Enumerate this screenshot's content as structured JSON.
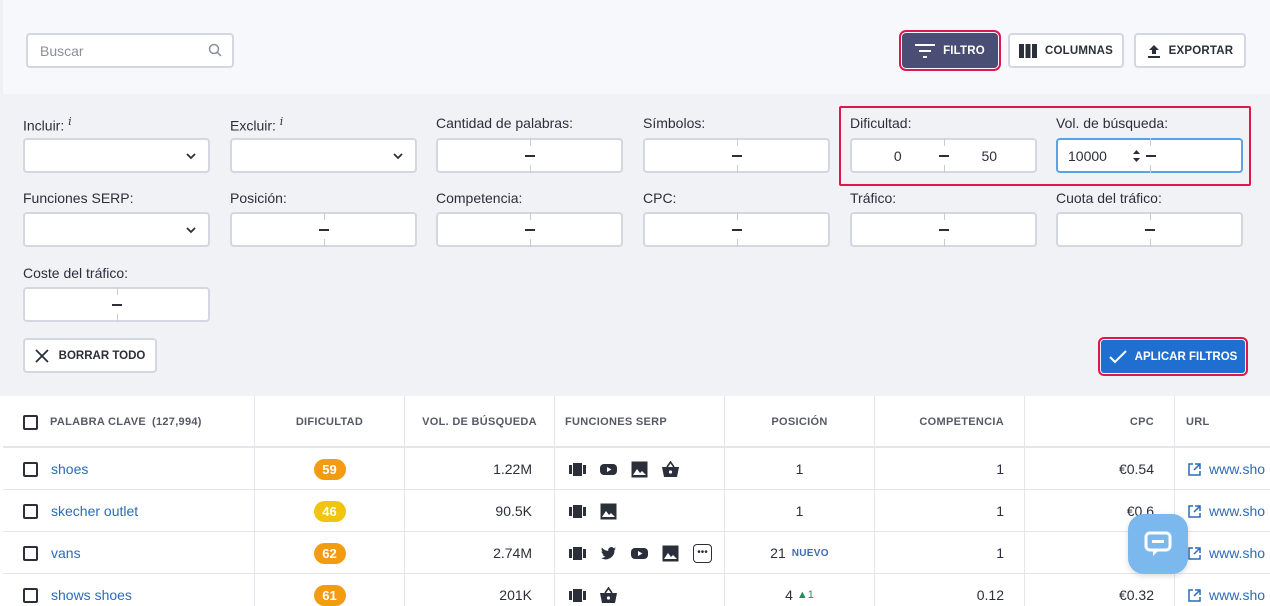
{
  "toolbar": {
    "search_placeholder": "Buscar",
    "filter_label": "FILTRO",
    "columns_label": "COLUMNAS",
    "export_label": "EXPORTAR"
  },
  "filters": {
    "incluir": "Incluir:",
    "excluir": "Excluir:",
    "info_glyph": "i",
    "cantidad": "Cantidad de palabras:",
    "simbolos": "Símbolos:",
    "dificultad": "Dificultad:",
    "dificultad_min": "0",
    "dificultad_max": "50",
    "volumen": "Vol. de búsqueda:",
    "volumen_min": "10000",
    "funciones": "Funciones SERP:",
    "posicion": "Posición:",
    "competencia": "Competencia:",
    "cpc": "CPC:",
    "trafico": "Tráfico:",
    "cuota": "Cuota del tráfico:",
    "coste": "Coste del tráfico:",
    "clear_label": "BORRAR TODO",
    "apply_label": "APLICAR FILTROS"
  },
  "table": {
    "headers": {
      "keyword": "PALABRA CLAVE",
      "keyword_count": "(127,994)",
      "difficulty": "DIFICULTAD",
      "volume": "VOL. DE BÚSQUEDA",
      "serp": "FUNCIONES SERP",
      "position": "POSICIÓN",
      "competition": "COMPETENCIA",
      "cpc": "CPC",
      "url": "URL"
    },
    "rows": [
      {
        "keyword": "shoes",
        "difficulty": "59",
        "difficulty_color": "#f39c12",
        "volume": "1.22M",
        "serp": [
          "carousel-icon",
          "youtube-icon",
          "image-icon",
          "shopping-icon"
        ],
        "position": "1",
        "position_tag": "",
        "position_change": "",
        "competition": "1",
        "cpc": "€0.54",
        "url": "www.sho"
      },
      {
        "keyword": "skecher outlet",
        "difficulty": "46",
        "difficulty_color": "#f1c40f",
        "volume": "90.5K",
        "serp": [
          "carousel-icon",
          "image-icon"
        ],
        "position": "1",
        "position_tag": "",
        "position_change": "",
        "competition": "1",
        "cpc": "€0.6",
        "url": "www.sho"
      },
      {
        "keyword": "vans",
        "difficulty": "62",
        "difficulty_color": "#f39c12",
        "volume": "2.74M",
        "serp": [
          "carousel-icon",
          "twitter-icon",
          "youtube-icon",
          "image-icon",
          "more-icon"
        ],
        "position": "21",
        "position_tag": "NUEVO",
        "position_change": "",
        "competition": "1",
        "cpc": "€0.",
        "url": "www.sho"
      },
      {
        "keyword": "shows shoes",
        "difficulty": "61",
        "difficulty_color": "#f39c12",
        "volume": "201K",
        "serp": [
          "carousel-icon",
          "shopping-icon"
        ],
        "position": "4",
        "position_tag": "",
        "position_change": "1",
        "competition": "0.12",
        "cpc": "€0.32",
        "url": "www.sho"
      }
    ]
  }
}
